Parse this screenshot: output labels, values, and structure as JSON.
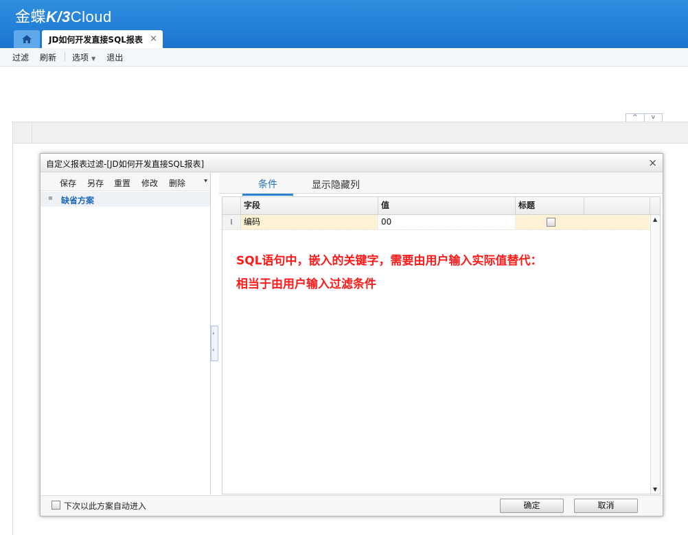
{
  "app": {
    "logo_cn": "金蝶",
    "logo_k3": "K/3",
    "logo_cloud": "Cloud",
    "home_icon": "home-icon",
    "doc_tab_label": "JD如何开发直接SQL报表",
    "doc_tab_close": "×"
  },
  "toolbar": {
    "filter": "过滤",
    "refresh": "刷新",
    "options": "选项",
    "exit": "退出"
  },
  "pager": {
    "up": "^",
    "down": "v"
  },
  "dialog": {
    "title": "自定义报表过滤-[JD如何开发直接SQL报表]",
    "close": "×",
    "left_toolbar": {
      "save": "保存",
      "save_as": "另存",
      "reset": "重置",
      "modify": "修改",
      "delete": "删除"
    },
    "scheme": {
      "label": "缺省方案"
    },
    "tabs": {
      "conditions": "条件",
      "show_hidden": "显示隐藏列"
    },
    "grid": {
      "headers": [
        "字段",
        "值",
        "标题"
      ],
      "rows": [
        {
          "indicator": "I",
          "field": "编码",
          "value": "00",
          "title_checked": false
        }
      ]
    },
    "annotation": {
      "line1": "SQL语句中，嵌入的关键字，需要由用户输入实际值替代：",
      "line2": "相当于由用户输入过滤条件"
    },
    "footer": {
      "auto_enter_label": "下次以此方案自动进入",
      "ok": "确定",
      "cancel": "取消"
    }
  },
  "colors": {
    "header_blue": "#1c74cf",
    "tab_active_blue": "#1f74c4",
    "annotation_red": "#ff1a1a",
    "row_highlight": "#fdf2d6"
  }
}
